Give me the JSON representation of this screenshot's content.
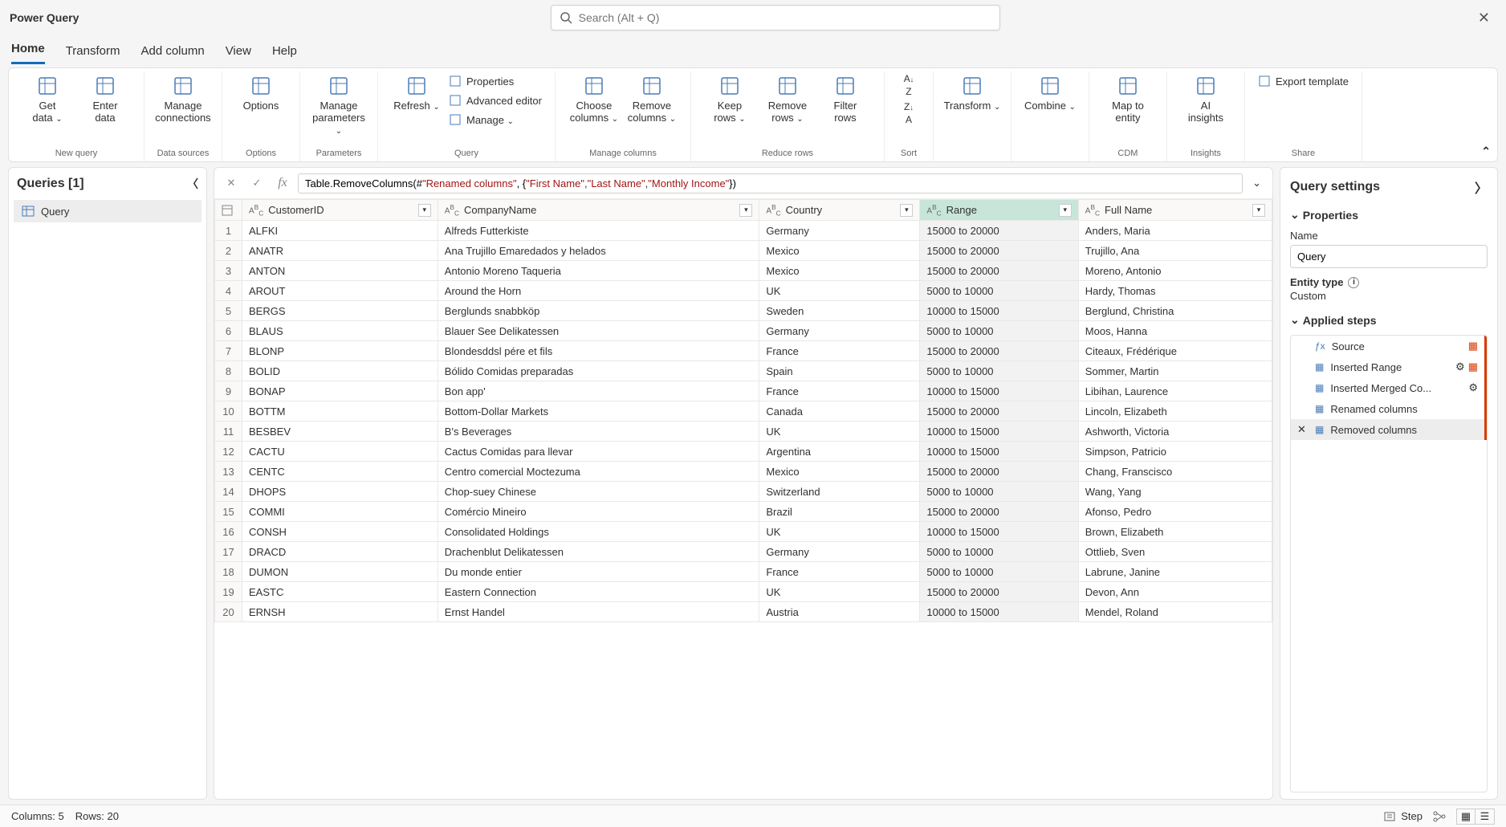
{
  "app_title": "Power Query",
  "search_placeholder": "Search (Alt + Q)",
  "tabs": [
    "Home",
    "Transform",
    "Add column",
    "View",
    "Help"
  ],
  "active_tab": 0,
  "ribbon": {
    "groups": [
      {
        "label": "New query",
        "items": [
          {
            "label": "Get\ndata",
            "chev": true
          },
          {
            "label": "Enter\ndata"
          }
        ]
      },
      {
        "label": "Data sources",
        "items": [
          {
            "label": "Manage\nconnections"
          }
        ]
      },
      {
        "label": "Options",
        "items": [
          {
            "label": "Options"
          }
        ]
      },
      {
        "label": "Parameters",
        "items": [
          {
            "label": "Manage\nparameters",
            "chev": true
          }
        ]
      },
      {
        "label": "Query",
        "items": [
          {
            "label": "Refresh",
            "chev": true
          }
        ],
        "stack": [
          {
            "label": "Properties"
          },
          {
            "label": "Advanced editor"
          },
          {
            "label": "Manage",
            "chev": true
          }
        ]
      },
      {
        "label": "Manage columns",
        "items": [
          {
            "label": "Choose\ncolumns",
            "chev": true
          },
          {
            "label": "Remove\ncolumns",
            "chev": true
          }
        ]
      },
      {
        "label": "Reduce rows",
        "items": [
          {
            "label": "Keep\nrows",
            "chev": true
          },
          {
            "label": "Remove\nrows",
            "chev": true
          },
          {
            "label": "Filter\nrows"
          }
        ]
      },
      {
        "label": "Sort",
        "items": [
          {
            "label": ""
          }
        ],
        "sort": true
      },
      {
        "label": "",
        "items": [
          {
            "label": "Transform",
            "chev": true
          }
        ]
      },
      {
        "label": "",
        "items": [
          {
            "label": "Combine",
            "chev": true
          }
        ]
      },
      {
        "label": "CDM",
        "items": [
          {
            "label": "Map to\nentity"
          }
        ]
      },
      {
        "label": "Insights",
        "items": [
          {
            "label": "AI\ninsights"
          }
        ]
      },
      {
        "label": "Share",
        "items": [],
        "stack": [
          {
            "label": "Export template"
          }
        ]
      }
    ]
  },
  "queries": {
    "title": "Queries [1]",
    "items": [
      "Query"
    ]
  },
  "formula": {
    "prefix": "Table.RemoveColumns(#",
    "arg0": "\"Renamed columns\"",
    "mid": ", {",
    "s1": "\"First Name\"",
    "s2": "\"Last Name\"",
    "s3": "\"Monthly Income\"",
    "suffix": "})"
  },
  "columns": [
    "CustomerID",
    "CompanyName",
    "Country",
    "Range",
    "Full Name"
  ],
  "rows": [
    [
      "ALFKI",
      "Alfreds Futterkiste",
      "Germany",
      "15000 to 20000",
      "Anders, Maria"
    ],
    [
      "ANATR",
      "Ana Trujillo Emaredados y helados",
      "Mexico",
      "15000 to 20000",
      "Trujillo, Ana"
    ],
    [
      "ANTON",
      "Antonio Moreno Taqueria",
      "Mexico",
      "15000 to 20000",
      "Moreno, Antonio"
    ],
    [
      "AROUT",
      "Around the Horn",
      "UK",
      "5000 to 10000",
      "Hardy, Thomas"
    ],
    [
      "BERGS",
      "Berglunds snabbköp",
      "Sweden",
      "10000 to 15000",
      "Berglund, Christina"
    ],
    [
      "BLAUS",
      "Blauer See Delikatessen",
      "Germany",
      "5000 to 10000",
      "Moos, Hanna"
    ],
    [
      "BLONP",
      "Blondesddsl pére et fils",
      "France",
      "15000 to 20000",
      "Citeaux, Frédérique"
    ],
    [
      "BOLID",
      "Bólido Comidas preparadas",
      "Spain",
      "5000 to 10000",
      "Sommer, Martin"
    ],
    [
      "BONAP",
      "Bon app'",
      "France",
      "10000 to 15000",
      "Libihan, Laurence"
    ],
    [
      "BOTTM",
      "Bottom-Dollar Markets",
      "Canada",
      "15000 to 20000",
      "Lincoln, Elizabeth"
    ],
    [
      "BESBEV",
      "B's Beverages",
      "UK",
      "10000 to 15000",
      "Ashworth, Victoria"
    ],
    [
      "CACTU",
      "Cactus Comidas para llevar",
      "Argentina",
      "10000 to 15000",
      "Simpson, Patricio"
    ],
    [
      "CENTC",
      "Centro comercial Moctezuma",
      "Mexico",
      "15000 to 20000",
      "Chang, Franscisco"
    ],
    [
      "DHOPS",
      "Chop-suey Chinese",
      "Switzerland",
      "5000 to 10000",
      "Wang, Yang"
    ],
    [
      "COMMI",
      "Comércio Mineiro",
      "Brazil",
      "15000 to 20000",
      "Afonso, Pedro"
    ],
    [
      "CONSH",
      "Consolidated Holdings",
      "UK",
      "10000 to 15000",
      "Brown, Elizabeth"
    ],
    [
      "DRACD",
      "Drachenblut Delikatessen",
      "Germany",
      "5000 to 10000",
      "Ottlieb, Sven"
    ],
    [
      "DUMON",
      "Du monde entier",
      "France",
      "5000 to 10000",
      "Labrune, Janine"
    ],
    [
      "EASTC",
      "Eastern Connection",
      "UK",
      "15000 to 20000",
      "Devon, Ann"
    ],
    [
      "ERNSH",
      "Ernst Handel",
      "Austria",
      "10000 to 15000",
      "Mendel, Roland"
    ]
  ],
  "settings": {
    "title": "Query settings",
    "properties": "Properties",
    "name_label": "Name",
    "name_value": "Query",
    "entity_label": "Entity type",
    "entity_value": "Custom",
    "applied_steps_label": "Applied steps",
    "steps": [
      {
        "label": "Source",
        "gear": false,
        "extra": true
      },
      {
        "label": "Inserted Range",
        "gear": true,
        "extra": true
      },
      {
        "label": "Inserted Merged Co...",
        "gear": true
      },
      {
        "label": "Renamed columns"
      },
      {
        "label": "Removed columns",
        "sel": true
      }
    ]
  },
  "status": {
    "cols": "Columns: 5",
    "rows": "Rows: 20",
    "step": "Step"
  }
}
